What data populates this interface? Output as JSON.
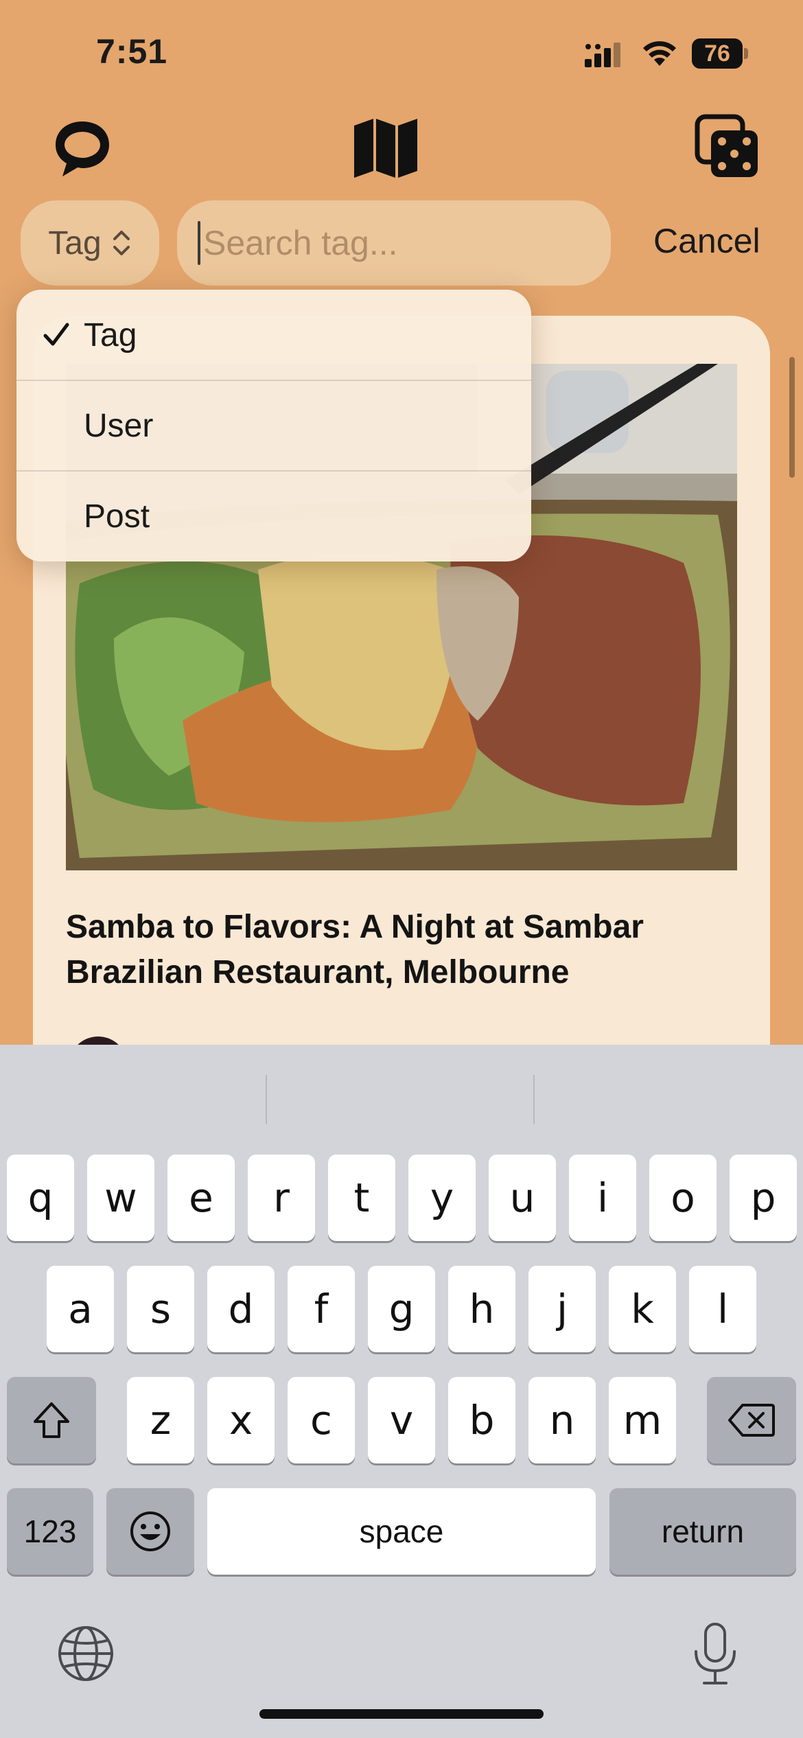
{
  "status_bar": {
    "time": "7:51",
    "battery": "76"
  },
  "top_bar": {
    "left_icon": "chat-bubble-icon",
    "center_icon": "map-icon",
    "right_icon": "dice-icon"
  },
  "search": {
    "picker_value": "Tag",
    "placeholder": "Search tag...",
    "cancel_label": "Cancel"
  },
  "menu": {
    "items": [
      {
        "label": "Tag",
        "selected": true
      },
      {
        "label": "User",
        "selected": false
      },
      {
        "label": "Post",
        "selected": false
      }
    ]
  },
  "post": {
    "title": "Samba to Flavors: A Night at Sambar Brazilian Restaurant, Melbourne"
  },
  "keyboard": {
    "row1": [
      "q",
      "w",
      "e",
      "r",
      "t",
      "y",
      "u",
      "i",
      "o",
      "p"
    ],
    "row2": [
      "a",
      "s",
      "d",
      "f",
      "g",
      "h",
      "j",
      "k",
      "l"
    ],
    "row3": [
      "z",
      "x",
      "c",
      "v",
      "b",
      "n",
      "m"
    ],
    "numbers_label": "123",
    "space_label": "space",
    "return_label": "return"
  }
}
